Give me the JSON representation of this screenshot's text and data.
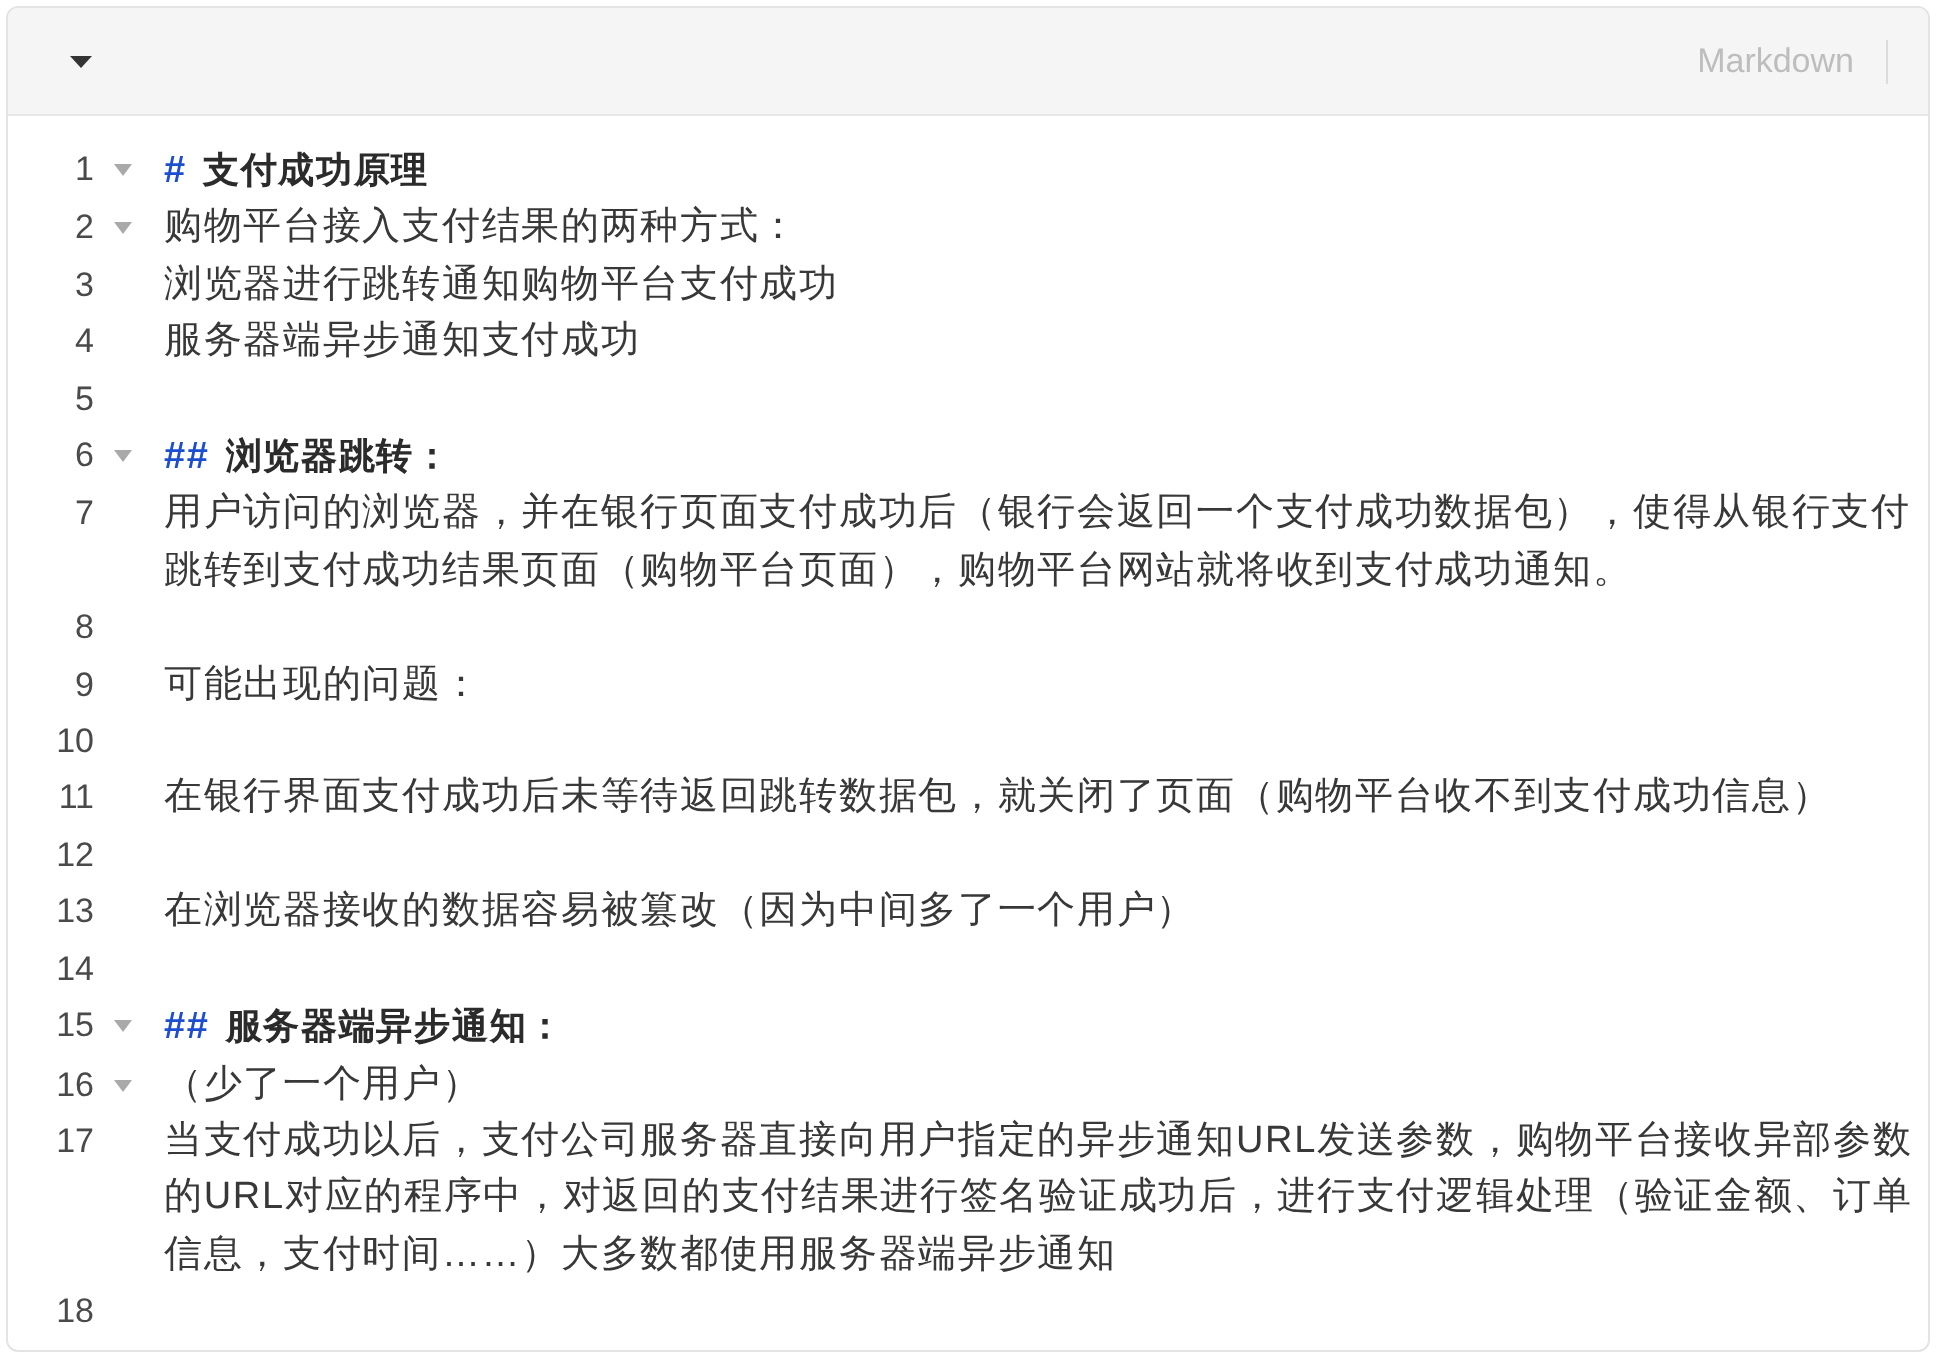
{
  "header": {
    "language": "Markdown"
  },
  "lines": [
    {
      "number": "1",
      "foldable": true,
      "kind": "heading",
      "marker": "#",
      "text": "支付成功原理"
    },
    {
      "number": "2",
      "foldable": true,
      "kind": "text",
      "text": "购物平台接入支付结果的两种方式："
    },
    {
      "number": "3",
      "foldable": false,
      "kind": "text",
      "text": "浏览器进行跳转通知购物平台支付成功"
    },
    {
      "number": "4",
      "foldable": false,
      "kind": "text",
      "text": "服务器端异步通知支付成功"
    },
    {
      "number": "5",
      "foldable": false,
      "kind": "blank"
    },
    {
      "number": "6",
      "foldable": true,
      "kind": "heading",
      "marker": "##",
      "text": "浏览器跳转："
    },
    {
      "number": "7",
      "foldable": false,
      "kind": "text",
      "text": "用户访问的浏览器，并在银行页面支付成功后（银行会返回一个支付成功数据包），使得从银行支付跳转到支付成功结果页面（购物平台页面），购物平台网站就将收到支付成功通知。"
    },
    {
      "number": "8",
      "foldable": false,
      "kind": "blank"
    },
    {
      "number": "9",
      "foldable": false,
      "kind": "text",
      "text": "可能出现的问题："
    },
    {
      "number": "10",
      "foldable": false,
      "kind": "blank"
    },
    {
      "number": "11",
      "foldable": false,
      "kind": "text",
      "text": "在银行界面支付成功后未等待返回跳转数据包，就关闭了页面（购物平台收不到支付成功信息）"
    },
    {
      "number": "12",
      "foldable": false,
      "kind": "blank"
    },
    {
      "number": "13",
      "foldable": false,
      "kind": "text",
      "text": "在浏览器接收的数据容易被篡改（因为中间多了一个用户）"
    },
    {
      "number": "14",
      "foldable": false,
      "kind": "blank"
    },
    {
      "number": "15",
      "foldable": true,
      "kind": "heading",
      "marker": "##",
      "text": "服务器端异步通知："
    },
    {
      "number": "16",
      "foldable": true,
      "kind": "text",
      "text": "（少了一个用户）"
    },
    {
      "number": "17",
      "foldable": false,
      "kind": "text",
      "text": "当支付成功以后，支付公司服务器直接向用户指定的异步通知URL发送参数，购物平台接收异部参数的URL对应的程序中，对返回的支付结果进行签名验证成功后，进行支付逻辑处理（验证金额、订单信息，支付时间……）大多数都使用服务器端异步通知"
    },
    {
      "number": "18",
      "foldable": false,
      "kind": "blank"
    }
  ]
}
